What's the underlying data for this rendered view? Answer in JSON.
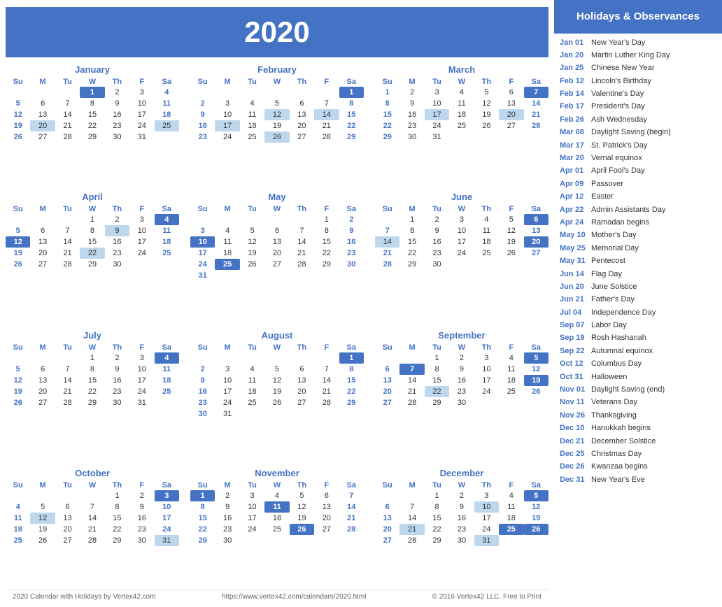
{
  "year": "2020",
  "header_title": "Holidays & Observances",
  "footer": {
    "left": "2020 Calendar with Holidays by Vertex42.com",
    "center": "https://www.vertex42.com/calendars/2020.html",
    "right": "© 2016 Vertex42 LLC. Free to Print"
  },
  "holidays": [
    {
      "date": "Jan 01",
      "name": "New Year's Day"
    },
    {
      "date": "Jan 20",
      "name": "Martin Luther King Day"
    },
    {
      "date": "Jan 25",
      "name": "Chinese New Year"
    },
    {
      "date": "Feb 12",
      "name": "Lincoln's Birthday"
    },
    {
      "date": "Feb 14",
      "name": "Valentine's Day"
    },
    {
      "date": "Feb 17",
      "name": "President's Day"
    },
    {
      "date": "Feb 26",
      "name": "Ash Wednesday"
    },
    {
      "date": "Mar 08",
      "name": "Daylight Saving (begin)"
    },
    {
      "date": "Mar 17",
      "name": "St. Patrick's Day"
    },
    {
      "date": "Mar 20",
      "name": "Vernal equinox"
    },
    {
      "date": "Apr 01",
      "name": "April Fool's Day"
    },
    {
      "date": "Apr 09",
      "name": "Passover"
    },
    {
      "date": "Apr 12",
      "name": "Easter"
    },
    {
      "date": "Apr 22",
      "name": "Admin Assistants Day"
    },
    {
      "date": "Apr 24",
      "name": "Ramadan begins"
    },
    {
      "date": "May 10",
      "name": "Mother's Day"
    },
    {
      "date": "May 25",
      "name": "Memorial Day"
    },
    {
      "date": "May 31",
      "name": "Pentecost"
    },
    {
      "date": "Jun 14",
      "name": "Flag Day"
    },
    {
      "date": "Jun 20",
      "name": "June Solstice"
    },
    {
      "date": "Jun 21",
      "name": "Father's Day"
    },
    {
      "date": "Jul 04",
      "name": "Independence Day"
    },
    {
      "date": "Sep 07",
      "name": "Labor Day"
    },
    {
      "date": "Sep 19",
      "name": "Rosh Hashanah"
    },
    {
      "date": "Sep 22",
      "name": "Autumnal equinox"
    },
    {
      "date": "Oct 12",
      "name": "Columbus Day"
    },
    {
      "date": "Oct 31",
      "name": "Halloween"
    },
    {
      "date": "Nov 01",
      "name": "Daylight Saving (end)"
    },
    {
      "date": "Nov 11",
      "name": "Veterans Day"
    },
    {
      "date": "Nov 26",
      "name": "Thanksgiving"
    },
    {
      "date": "Dec 10",
      "name": "Hanukkah begins"
    },
    {
      "date": "Dec 21",
      "name": "December Solstice"
    },
    {
      "date": "Dec 25",
      "name": "Christmas Day"
    },
    {
      "date": "Dec 26",
      "name": "Kwanzaa begins"
    },
    {
      "date": "Dec 31",
      "name": "New Year's Eve"
    }
  ],
  "months": [
    {
      "name": "January",
      "weeks": [
        [
          "",
          "",
          "",
          "1",
          "2",
          "3",
          "4"
        ],
        [
          "5",
          "6",
          "7",
          "8",
          "9",
          "10",
          "11"
        ],
        [
          "12",
          "13",
          "14",
          "15",
          "16",
          "17",
          "18"
        ],
        [
          "19",
          "20",
          "21",
          "22",
          "23",
          "24",
          "25"
        ],
        [
          "26",
          "27",
          "28",
          "29",
          "30",
          "31",
          ""
        ]
      ],
      "highlights_blue": [
        "1"
      ],
      "highlights_light": [
        "20",
        "25"
      ],
      "sunday_highlights": []
    },
    {
      "name": "February",
      "weeks": [
        [
          "",
          "",
          "",
          "",
          "",
          "",
          "1"
        ],
        [
          "2",
          "3",
          "4",
          "5",
          "6",
          "7",
          "8"
        ],
        [
          "9",
          "10",
          "11",
          "12",
          "13",
          "14",
          "15"
        ],
        [
          "16",
          "17",
          "18",
          "19",
          "20",
          "21",
          "22"
        ],
        [
          "23",
          "24",
          "25",
          "26",
          "27",
          "28",
          "29"
        ]
      ],
      "highlights_blue": [
        "1"
      ],
      "highlights_light": [
        "12",
        "14",
        "17",
        "26"
      ],
      "sunday_highlights": []
    },
    {
      "name": "March",
      "weeks": [
        [
          "1",
          "2",
          "3",
          "4",
          "5",
          "6",
          "7"
        ],
        [
          "8",
          "9",
          "10",
          "11",
          "12",
          "13",
          "14"
        ],
        [
          "15",
          "16",
          "17",
          "18",
          "19",
          "20",
          "21"
        ],
        [
          "22",
          "23",
          "24",
          "25",
          "26",
          "27",
          "28"
        ],
        [
          "29",
          "30",
          "31",
          "",
          "",
          "",
          ""
        ]
      ],
      "highlights_blue": [
        "7"
      ],
      "highlights_light": [
        "17",
        "20"
      ],
      "sunday_highlights": []
    },
    {
      "name": "April",
      "weeks": [
        [
          "",
          "",
          "",
          "1",
          "2",
          "3",
          "4"
        ],
        [
          "5",
          "6",
          "7",
          "8",
          "9",
          "10",
          "11"
        ],
        [
          "12",
          "13",
          "14",
          "15",
          "16",
          "17",
          "18"
        ],
        [
          "19",
          "20",
          "21",
          "22",
          "23",
          "24",
          "25"
        ],
        [
          "26",
          "27",
          "28",
          "29",
          "30",
          "",
          ""
        ]
      ],
      "highlights_blue": [
        "4",
        "12"
      ],
      "highlights_light": [
        "9",
        "22"
      ],
      "sunday_highlights": []
    },
    {
      "name": "May",
      "weeks": [
        [
          "",
          "",
          "",
          "",
          "",
          "1",
          "2"
        ],
        [
          "3",
          "4",
          "5",
          "6",
          "7",
          "8",
          "9"
        ],
        [
          "10",
          "11",
          "12",
          "13",
          "14",
          "15",
          "16"
        ],
        [
          "17",
          "18",
          "19",
          "20",
          "21",
          "22",
          "23"
        ],
        [
          "24",
          "25",
          "26",
          "27",
          "28",
          "29",
          "30"
        ],
        [
          "31",
          "",
          "",
          "",
          "",
          "",
          ""
        ]
      ],
      "highlights_blue": [
        "10",
        "25"
      ],
      "highlights_light": [],
      "sunday_highlights": []
    },
    {
      "name": "June",
      "weeks": [
        [
          "",
          "1",
          "2",
          "3",
          "4",
          "5",
          "6"
        ],
        [
          "7",
          "8",
          "9",
          "10",
          "11",
          "12",
          "13"
        ],
        [
          "14",
          "15",
          "16",
          "17",
          "18",
          "19",
          "20"
        ],
        [
          "21",
          "22",
          "23",
          "24",
          "25",
          "26",
          "27"
        ],
        [
          "28",
          "29",
          "30",
          "",
          "",
          "",
          ""
        ]
      ],
      "highlights_blue": [
        "6",
        "20"
      ],
      "highlights_light": [
        "14"
      ],
      "sunday_highlights": []
    },
    {
      "name": "July",
      "weeks": [
        [
          "",
          "",
          "",
          "1",
          "2",
          "3",
          "4"
        ],
        [
          "5",
          "6",
          "7",
          "8",
          "9",
          "10",
          "11"
        ],
        [
          "12",
          "13",
          "14",
          "15",
          "16",
          "17",
          "18"
        ],
        [
          "19",
          "20",
          "21",
          "22",
          "23",
          "24",
          "25"
        ],
        [
          "26",
          "27",
          "28",
          "29",
          "30",
          "31",
          ""
        ]
      ],
      "highlights_blue": [
        "4"
      ],
      "highlights_light": [],
      "sunday_highlights": []
    },
    {
      "name": "August",
      "weeks": [
        [
          "",
          "",
          "",
          "",
          "",
          "",
          "1"
        ],
        [
          "2",
          "3",
          "4",
          "5",
          "6",
          "7",
          "8"
        ],
        [
          "9",
          "10",
          "11",
          "12",
          "13",
          "14",
          "15"
        ],
        [
          "16",
          "17",
          "18",
          "19",
          "20",
          "21",
          "22"
        ],
        [
          "23",
          "24",
          "25",
          "26",
          "27",
          "28",
          "29"
        ],
        [
          "30",
          "31",
          "",
          "",
          "",
          "",
          ""
        ]
      ],
      "highlights_blue": [
        "1"
      ],
      "highlights_light": [],
      "sunday_highlights": []
    },
    {
      "name": "September",
      "weeks": [
        [
          "",
          "",
          "1",
          "2",
          "3",
          "4",
          "5"
        ],
        [
          "6",
          "7",
          "8",
          "9",
          "10",
          "11",
          "12"
        ],
        [
          "13",
          "14",
          "15",
          "16",
          "17",
          "18",
          "19"
        ],
        [
          "20",
          "21",
          "22",
          "23",
          "24",
          "25",
          "26"
        ],
        [
          "27",
          "28",
          "29",
          "30",
          "",
          "",
          ""
        ]
      ],
      "highlights_blue": [
        "5",
        "7",
        "19"
      ],
      "highlights_light": [
        "22"
      ],
      "sunday_highlights": []
    },
    {
      "name": "October",
      "weeks": [
        [
          "",
          "",
          "",
          "",
          "1",
          "2",
          "3"
        ],
        [
          "4",
          "5",
          "6",
          "7",
          "8",
          "9",
          "10"
        ],
        [
          "11",
          "12",
          "13",
          "14",
          "15",
          "16",
          "17"
        ],
        [
          "18",
          "19",
          "20",
          "21",
          "22",
          "23",
          "24"
        ],
        [
          "25",
          "26",
          "27",
          "28",
          "29",
          "30",
          "31"
        ]
      ],
      "highlights_blue": [
        "3"
      ],
      "highlights_light": [
        "12",
        "31"
      ],
      "sunday_highlights": []
    },
    {
      "name": "November",
      "weeks": [
        [
          "1",
          "2",
          "3",
          "4",
          "5",
          "6",
          "7"
        ],
        [
          "8",
          "9",
          "10",
          "11",
          "12",
          "13",
          "14"
        ],
        [
          "15",
          "16",
          "17",
          "18",
          "19",
          "20",
          "21"
        ],
        [
          "22",
          "23",
          "24",
          "25",
          "26",
          "27",
          "28"
        ],
        [
          "29",
          "30",
          "",
          "",
          "",
          "",
          ""
        ]
      ],
      "highlights_blue": [
        "1",
        "11",
        "26"
      ],
      "highlights_light": [],
      "sunday_highlights": []
    },
    {
      "name": "December",
      "weeks": [
        [
          "",
          "",
          "1",
          "2",
          "3",
          "4",
          "5"
        ],
        [
          "6",
          "7",
          "8",
          "9",
          "10",
          "11",
          "12"
        ],
        [
          "13",
          "14",
          "15",
          "16",
          "17",
          "18",
          "19"
        ],
        [
          "20",
          "21",
          "22",
          "23",
          "24",
          "25",
          "26"
        ],
        [
          "27",
          "28",
          "29",
          "30",
          "31",
          "",
          ""
        ]
      ],
      "highlights_blue": [
        "5",
        "25",
        "26"
      ],
      "highlights_light": [
        "10",
        "21",
        "31"
      ],
      "sunday_highlights": []
    }
  ],
  "day_headers": [
    "Su",
    "M",
    "Tu",
    "W",
    "Th",
    "F",
    "Sa"
  ]
}
